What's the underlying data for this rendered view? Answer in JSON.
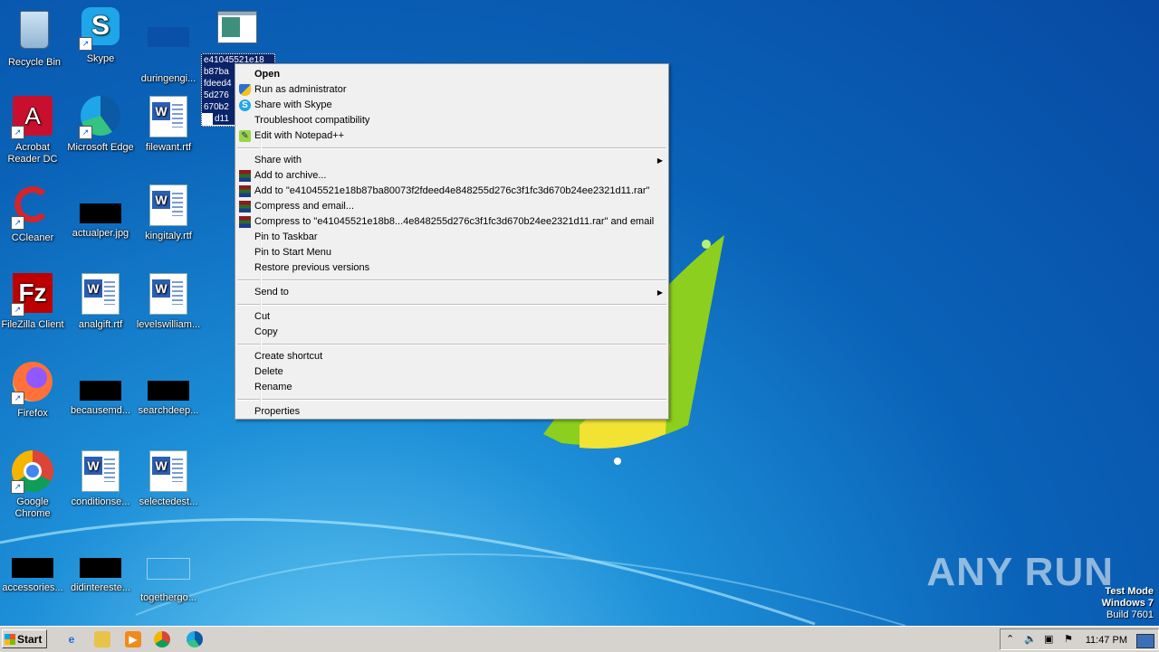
{
  "desktop": {
    "icons": [
      {
        "label": "Recycle Bin"
      },
      {
        "label": "Skype"
      },
      {
        "label": "duringengi..."
      },
      {
        "label": "Acrobat Reader DC"
      },
      {
        "label": "Microsoft Edge"
      },
      {
        "label": "filewant.rtf"
      },
      {
        "label": "CCleaner"
      },
      {
        "label": "actualper.jpg"
      },
      {
        "label": "kingitaly.rtf"
      },
      {
        "label": "FileZilla Client"
      },
      {
        "label": "analgift.rtf"
      },
      {
        "label": "levelswilliam..."
      },
      {
        "label": "Firefox"
      },
      {
        "label": "becausemd..."
      },
      {
        "label": "searchdeep..."
      },
      {
        "label": "Google Chrome"
      },
      {
        "label": "conditionse..."
      },
      {
        "label": "selectedest..."
      },
      {
        "label": "accessories..."
      },
      {
        "label": "didintereste..."
      },
      {
        "label": "togethergo..."
      }
    ],
    "selected_file_lines": [
      "e41045521e18",
      "b87ba",
      "fdeed4",
      "5d276",
      "670b2",
      "d11"
    ]
  },
  "context_menu": {
    "items": [
      {
        "label": "Open",
        "icon": ""
      },
      {
        "label": "Run as administrator",
        "icon": "shield-icon"
      },
      {
        "label": "Share with Skype",
        "icon": "skype-icon"
      },
      {
        "label": "Troubleshoot compatibility",
        "icon": ""
      },
      {
        "label": "Edit with Notepad++",
        "icon": "notepadpp-icon"
      },
      {
        "label": "Share with",
        "icon": ""
      },
      {
        "label": "Add to archive...",
        "icon": "winrar-icon"
      },
      {
        "label": "Add to \"e41045521e18b87ba80073f2fdeed4e848255d276c3f1fc3d670b24ee2321d11.rar\"",
        "icon": "winrar-icon"
      },
      {
        "label": "Compress and email...",
        "icon": "winrar-icon"
      },
      {
        "label": "Compress to \"e41045521e18b8...4e848255d276c3f1fc3d670b24ee2321d11.rar\" and email",
        "icon": "winrar-icon"
      },
      {
        "label": "Pin to Taskbar",
        "icon": ""
      },
      {
        "label": "Pin to Start Menu",
        "icon": ""
      },
      {
        "label": "Restore previous versions",
        "icon": ""
      },
      {
        "label": "Send to",
        "icon": ""
      },
      {
        "label": "Cut",
        "icon": ""
      },
      {
        "label": "Copy",
        "icon": ""
      },
      {
        "label": "Create shortcut",
        "icon": ""
      },
      {
        "label": "Delete",
        "icon": ""
      },
      {
        "label": "Rename",
        "icon": ""
      },
      {
        "label": "Properties",
        "icon": ""
      }
    ]
  },
  "watermark": "ANY RUN",
  "test_mode": {
    "line1": "Test Mode",
    "line2": "Windows 7",
    "line3": "Build 7601"
  },
  "taskbar": {
    "start_label": "Start",
    "clock": "11:47 PM"
  },
  "colors": {
    "menu_bg": "#f0f0f0",
    "taskbar_bg": "#d6d3ce",
    "selection": "#0a246a"
  }
}
